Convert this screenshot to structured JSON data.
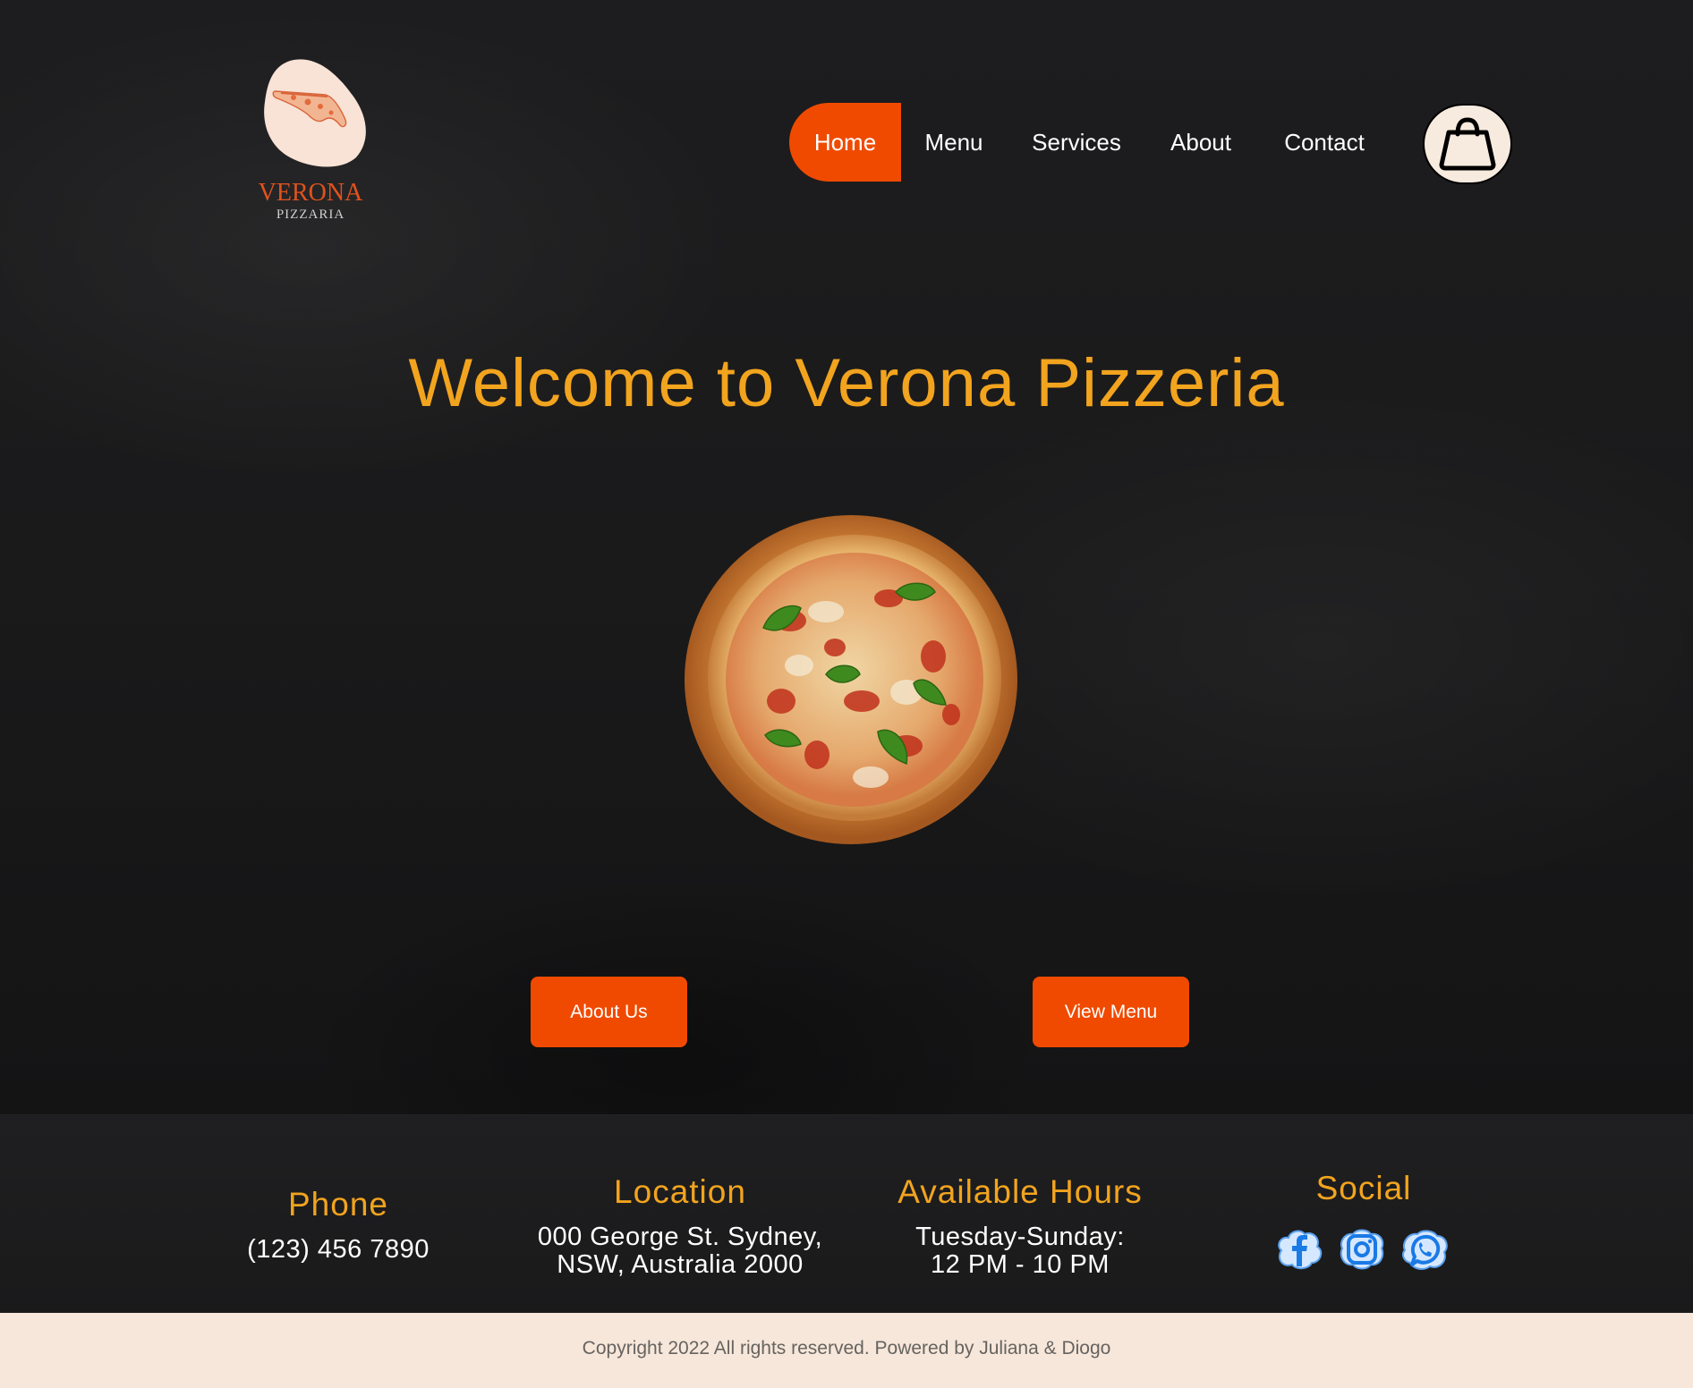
{
  "brand": {
    "name": "VERONA",
    "subtitle": "PIZZARIA"
  },
  "nav": {
    "items": [
      "Home",
      "Menu",
      "Services",
      "About",
      "Contact"
    ],
    "active": "Home"
  },
  "cart": {
    "icon": "shopping-bag-icon"
  },
  "hero": {
    "headline": "Welcome to Verona Pizzeria",
    "image": "pizza-image",
    "buttons": {
      "about": "About Us",
      "menu": "View Menu"
    }
  },
  "footer": {
    "phone": {
      "title": "Phone",
      "value": "(123) 456 7890"
    },
    "location": {
      "title": "Location",
      "line1": "000 George St. Sydney,",
      "line2": "NSW, Australia 2000"
    },
    "hours": {
      "title": "Available Hours",
      "line1": "Tuesday-Sunday:",
      "line2": "12 PM - 10 PM"
    },
    "social": {
      "title": "Social",
      "icons": [
        "facebook-icon",
        "instagram-icon",
        "whatsapp-icon"
      ]
    }
  },
  "copyright": "Copyright 2022 All rights reserved. Powered by Juliana & Diogo",
  "colors": {
    "accent": "#f04a00",
    "headline": "#f2a41e",
    "background": "#1b1b1c",
    "cream": "#f7e7da"
  }
}
